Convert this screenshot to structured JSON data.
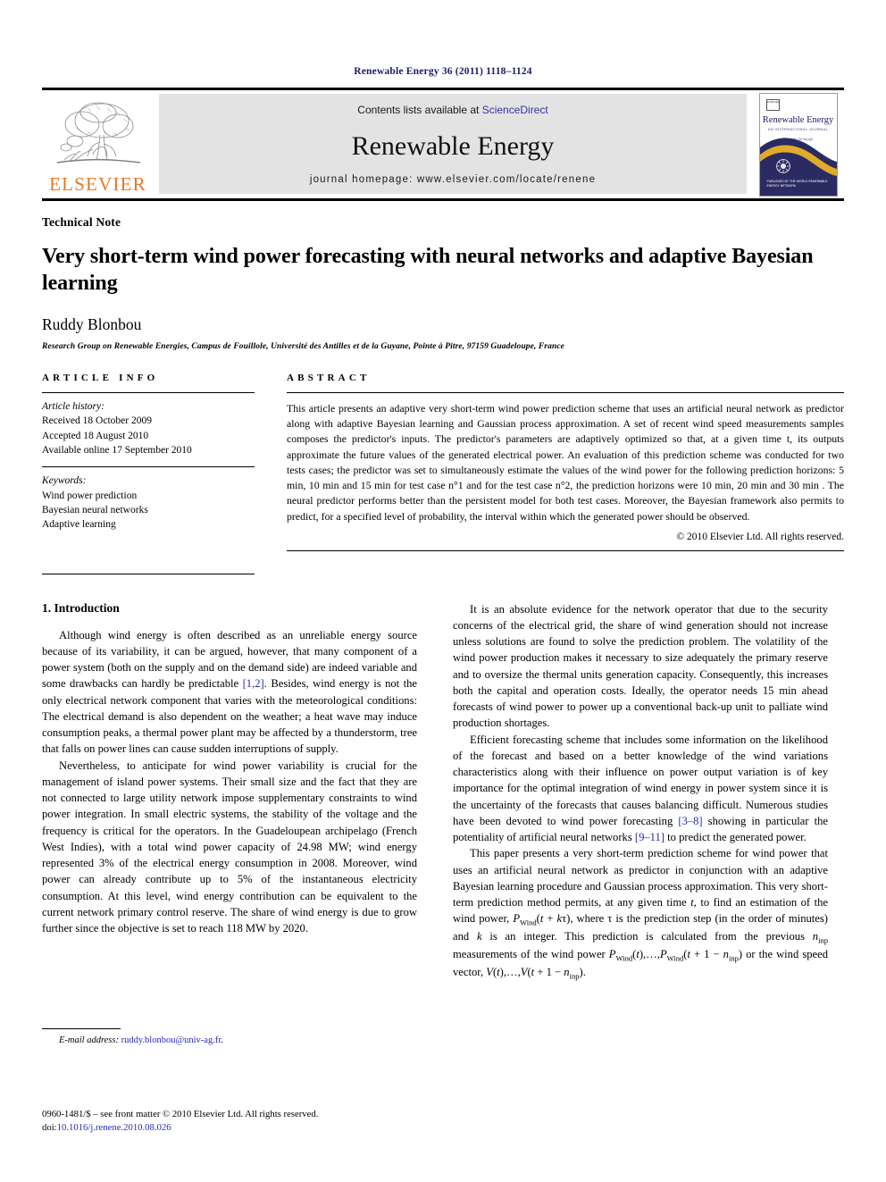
{
  "running_head": "Renewable Energy 36 (2011) 1118–1124",
  "masthead": {
    "publisher_wordmark": "ELSEVIER",
    "contents_prefix": "Contents lists available at ",
    "contents_link": "ScienceDirect",
    "journal_name": "Renewable Energy",
    "homepage": "journal homepage: www.elsevier.com/locate/renene",
    "cover": {
      "mark": "ELSEVIER",
      "title": "Renewable Energy",
      "subtitle": "AN INTERNATIONAL JOURNAL",
      "editor": "Edited by Ali Sayigh",
      "footer": "PUBLISHED BY THE WORLD RENEWABLE ENERGY NETWORK"
    }
  },
  "article": {
    "type": "Technical Note",
    "title": "Very short-term wind power forecasting with neural networks and adaptive Bayesian learning",
    "author": "Ruddy Blonbou",
    "affiliation": "Research Group on Renewable Energies, Campus de Fouillole, Université des Antilles et de la Guyane, Pointe à Pitre, 97159 Guadeloupe, France"
  },
  "article_info": {
    "heading": "ARTICLE INFO",
    "history_label": "Article history:",
    "history": [
      "Received 18 October 2009",
      "Accepted 18 August 2010",
      "Available online 17 September 2010"
    ],
    "keywords_label": "Keywords:",
    "keywords": [
      "Wind power prediction",
      "Bayesian neural networks",
      "Adaptive learning"
    ]
  },
  "abstract": {
    "heading": "ABSTRACT",
    "text": "This article presents an adaptive very short-term wind power prediction scheme that uses an artificial neural network as predictor along with adaptive Bayesian learning and Gaussian process approximation. A set of recent wind speed measurements samples composes the predictor's inputs. The predictor's parameters are adaptively optimized so that, at a given time t, its outputs approximate the future values of the generated electrical power. An evaluation of this prediction scheme was conducted for two tests cases; the predictor was set to simultaneously estimate the values of the wind power for the following prediction horizons: 5 min, 10 min and 15 min for test case n°1 and for the test case n°2, the prediction horizons were 10 min, 20 min and 30 min . The neural predictor performs better than the persistent model for both test cases. Moreover, the Bayesian framework also permits to predict, for a specified level of probability, the interval within which the generated power should be observed.",
    "copyright": "© 2010 Elsevier Ltd. All rights reserved."
  },
  "body": {
    "section_heading": "1. Introduction",
    "left_paragraph_1_a": "Although wind energy is often described as an unreliable energy source because of its variability, it can be argued, however, that many component of a power system (both on the supply and on the demand side) are indeed variable and some drawbacks can hardly be predictable ",
    "left_paragraph_1_cite": "[1,2]",
    "left_paragraph_1_b": ". Besides, wind energy is not the only electrical network component that varies with the meteorological conditions: The electrical demand is also dependent on the weather; a heat wave may induce consumption peaks, a thermal power plant may be affected by a thunderstorm, tree that falls on power lines can cause sudden interruptions of supply.",
    "left_paragraph_2": "Nevertheless, to anticipate for wind power variability is crucial for the management of island power systems. Their small size and the fact that they are not connected to large utility network impose supplementary constraints to wind power integration. In small electric systems, the stability of the voltage and the frequency is critical for the operators. In the Guadeloupean archipelago (French West Indies), with a total wind power capacity of 24.98 MW; wind energy represented 3% of the electrical energy consumption in 2008. Moreover, wind power can already contribute up to 5% of the instantaneous electricity consumption. At this level, wind energy contribution can be equivalent to the current network primary control reserve. The share of wind energy is due to grow further since the objective is set to reach 118 MW by 2020.",
    "right_paragraph_1": "It is an absolute evidence for the network operator that due to the security concerns of the electrical grid, the share of wind generation should not increase unless solutions are found to solve the prediction problem. The volatility of the wind power production makes it necessary to size adequately the primary reserve and to oversize the thermal units generation capacity. Consequently, this increases both the capital and operation costs. Ideally, the operator needs 15 min ahead forecasts of wind power to power up a conventional back-up unit to palliate wind production shortages.",
    "right_paragraph_2_a": "Efficient forecasting scheme that includes some information on the likelihood of the forecast and based on a better knowledge of the wind variations characteristics along with their influence on power output variation is of key importance for the optimal integration of wind energy in power system since it is the uncertainty of the forecasts that causes balancing difficult. Numerous studies have been devoted to wind power forecasting ",
    "right_paragraph_2_cite_1": "[3–8]",
    "right_paragraph_2_b": " showing in particular the potentiality of artificial neural networks ",
    "right_paragraph_2_cite_2": "[9–11]",
    "right_paragraph_2_c": " to predict the generated power.",
    "right_paragraph_3_a": "This paper presents a very short-term prediction scheme for wind power that uses an artificial neural network as predictor in conjunction with an adaptive Bayesian learning procedure and Gaussian process approximation. This very short-term prediction method permits, at any given time ",
    "right_paragraph_3_t": "t",
    "right_paragraph_3_b": ", to find an estimation of the wind power, ",
    "right_paragraph_3_eq1": "PWind(t + kτ)",
    "right_paragraph_3_c": ", where τ is the prediction step (in the order of minutes) and ",
    "right_paragraph_3_k": "k",
    "right_paragraph_3_d": " is an integer. This prediction is calculated from the previous ",
    "right_paragraph_3_ninp": "ninp",
    "right_paragraph_3_e": " measurements of the wind power ",
    "right_paragraph_3_eq2": "PWind(t),…,PWind(t + 1 − ninp)",
    "right_paragraph_3_f": " or the wind speed vector, ",
    "right_paragraph_3_eq3": "V(t),…,V(t + 1 − ninp)",
    "right_paragraph_3_g": "."
  },
  "footnote": {
    "label": "E-mail address:",
    "email": "ruddy.blonbou@univ-ag.fr",
    "period": "."
  },
  "page_footer": {
    "issn_line": "0960-1481/$ – see front matter © 2010 Elsevier Ltd. All rights reserved.",
    "doi_prefix": "doi:",
    "doi": "10.1016/j.renene.2010.08.026"
  },
  "colors": {
    "running_head": "#1a1a6e",
    "link": "#2a2ab0",
    "elsevier_orange": "#e87722",
    "masthead_gray": "#e3e3e3",
    "cover_navy": "#2b2b63",
    "cover_gold": "#e0aa2a"
  }
}
